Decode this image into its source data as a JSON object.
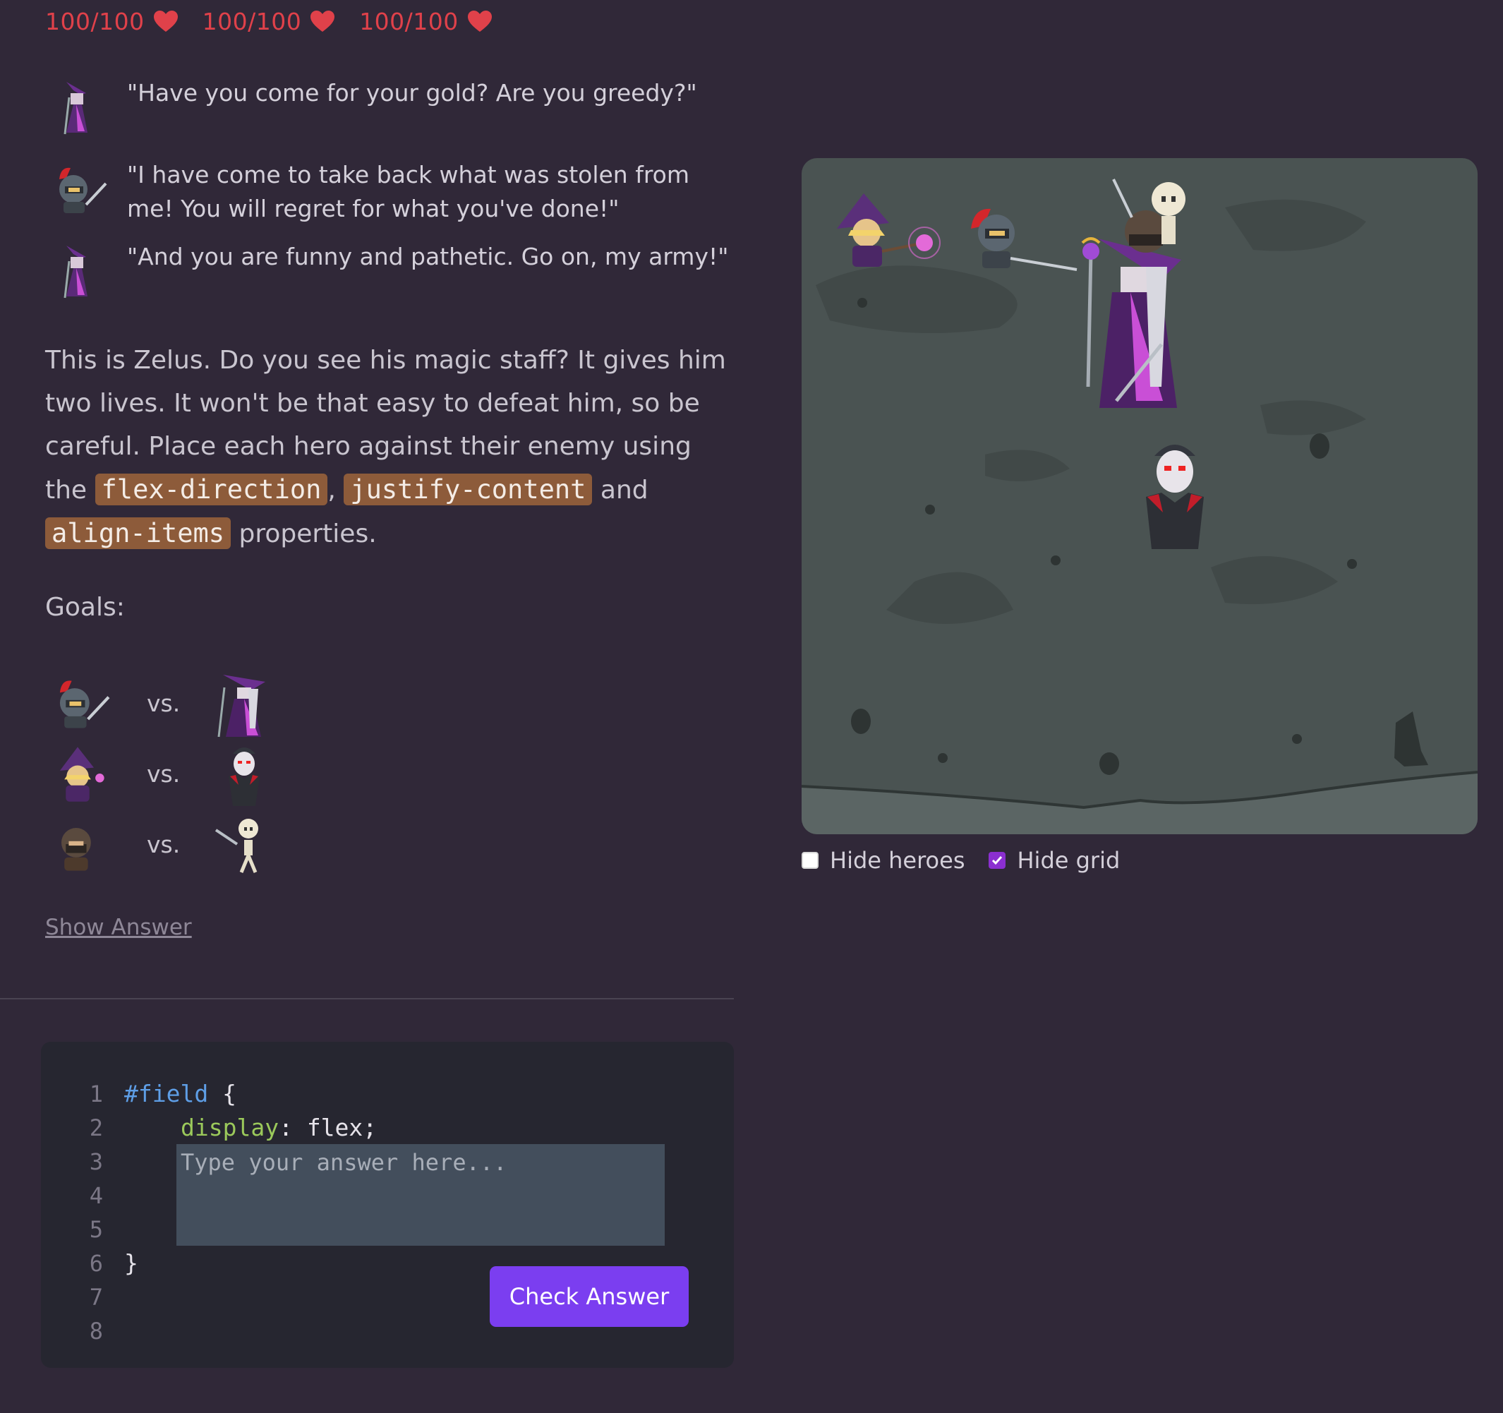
{
  "health": [
    {
      "label": "100/100"
    },
    {
      "label": "100/100"
    },
    {
      "label": "100/100"
    }
  ],
  "dialog": [
    {
      "speaker": "necromancer-icon",
      "text": "\"Have you come for your gold? Are you greedy?\""
    },
    {
      "speaker": "knight-icon",
      "text": "\"I have come to take back what was stolen from me! You will regret for what you've done!\""
    },
    {
      "speaker": "necromancer-icon",
      "text": "\"And you are funny and pathetic. Go on, my army!\""
    }
  ],
  "intro": {
    "part1": "This is Zelus. Do you see his magic staff? It gives him two lives. It won't be that easy to defeat him, so be careful. Place each hero against their enemy using the ",
    "code1": "flex-direction",
    "sep1": ", ",
    "code2": "justify-content",
    "sep2": " and ",
    "code3": "align-items",
    "part2": " properties."
  },
  "goals": {
    "title": "Goals:",
    "items": [
      {
        "hero": "knight-icon",
        "vs": "vs.",
        "enemy": "necromancer-icon"
      },
      {
        "hero": "mage-icon",
        "vs": "vs.",
        "enemy": "vampire-icon"
      },
      {
        "hero": "thief-icon",
        "vs": "vs.",
        "enemy": "skeleton-icon"
      }
    ]
  },
  "show_answer": "Show Answer",
  "editor": {
    "line_numbers": [
      "1",
      "2",
      "3",
      "4",
      "5",
      "6",
      "7",
      "8"
    ],
    "selector": "#field",
    "open_brace": " {",
    "property": "display",
    "value": ": flex;",
    "close_brace": "}",
    "placeholder": "Type your answer here...",
    "button": "Check Answer"
  },
  "toggles": {
    "hide_heroes": {
      "label": "Hide heroes",
      "checked": false
    },
    "hide_grid": {
      "label": "Hide grid",
      "checked": true
    }
  },
  "colors": {
    "background": "#302838",
    "health_red": "#e0414a",
    "inline_code_bg": "#8d5b3a",
    "button": "#7b3ef0",
    "board": "#4a5352"
  }
}
